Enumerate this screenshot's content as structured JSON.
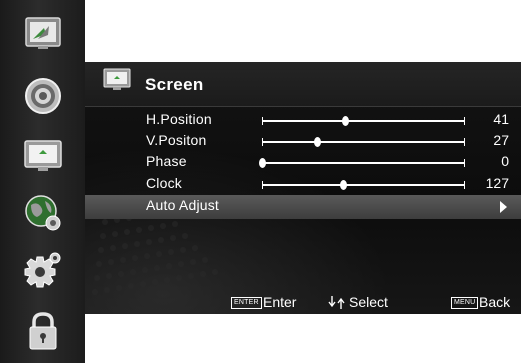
{
  "sidebar": {
    "items": [
      {
        "icon": "picture-icon"
      },
      {
        "icon": "speaker-icon"
      },
      {
        "icon": "screen-icon"
      },
      {
        "icon": "globe-icon"
      },
      {
        "icon": "gear-icon"
      },
      {
        "icon": "lock-icon"
      }
    ]
  },
  "panel": {
    "title": "Screen",
    "title_icon": "screen-icon",
    "rows": [
      {
        "label": "H.Position",
        "value": "41",
        "level": 0.41
      },
      {
        "label": "V.Positon",
        "value": "27",
        "level": 0.27
      },
      {
        "label": "Phase",
        "value": "0",
        "level": 0.0
      },
      {
        "label": "Clock",
        "value": "127",
        "level": 0.4
      }
    ],
    "action": {
      "label": "Auto Adjust",
      "icon": "arrow-right-icon"
    }
  },
  "footer": {
    "enter_key": "ENTER",
    "enter_label": "Enter",
    "select_icon": "up-down-arrows-icon",
    "select_label": "Select",
    "menu_key": "MENU",
    "back_label": "Back"
  },
  "colors": {
    "panel_bg": "#0c0c0c",
    "highlight": "#4a4a4a",
    "text": "#ffffff",
    "sidebar_bg": "#2c2c2c"
  }
}
